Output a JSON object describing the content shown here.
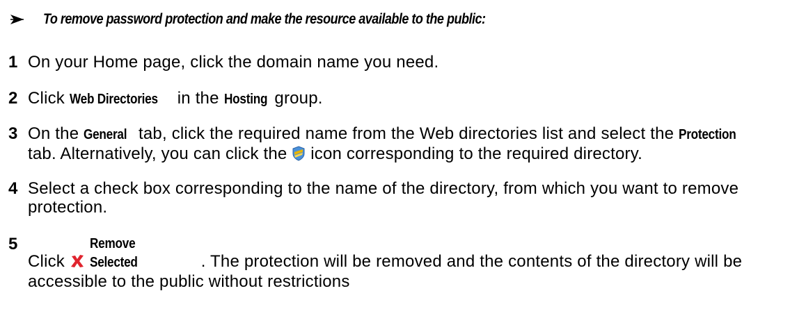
{
  "heading": {
    "bullet_icon": "arrow-bullet-icon",
    "text": "To remove password protection and make the resource available to the public:"
  },
  "steps": [
    {
      "number": "1",
      "text": "On your Home page, click the domain name you need."
    },
    {
      "number": "2",
      "pre": "Click ",
      "ui1": "Web Directories",
      "mid": " in the ",
      "ui2": "Hosting",
      "post": " group."
    },
    {
      "number": "3",
      "pre": "On the ",
      "ui1": "General",
      "mid": " tab, click the required name from the Web directories list and select the ",
      "ui2": "Protection",
      "mid2": " tab. Alternatively, you can click the ",
      "icon": "shield-icon",
      "post": " icon corresponding to the required directory."
    },
    {
      "number": "4",
      "text": "Select a check box corresponding to the name of the directory, from which you want to remove protection."
    },
    {
      "number": "5",
      "pre": "Click ",
      "icon": "remove-icon",
      "ui1": "Remove Selected",
      "post": ". The protection will be removed and the contents of the directory will be accessible to the public without restrictions"
    }
  ],
  "colors": {
    "text": "#000000",
    "shield_blue": "#4a90d9",
    "shield_gold": "#e8b400",
    "remove_red": "#e0242e"
  }
}
